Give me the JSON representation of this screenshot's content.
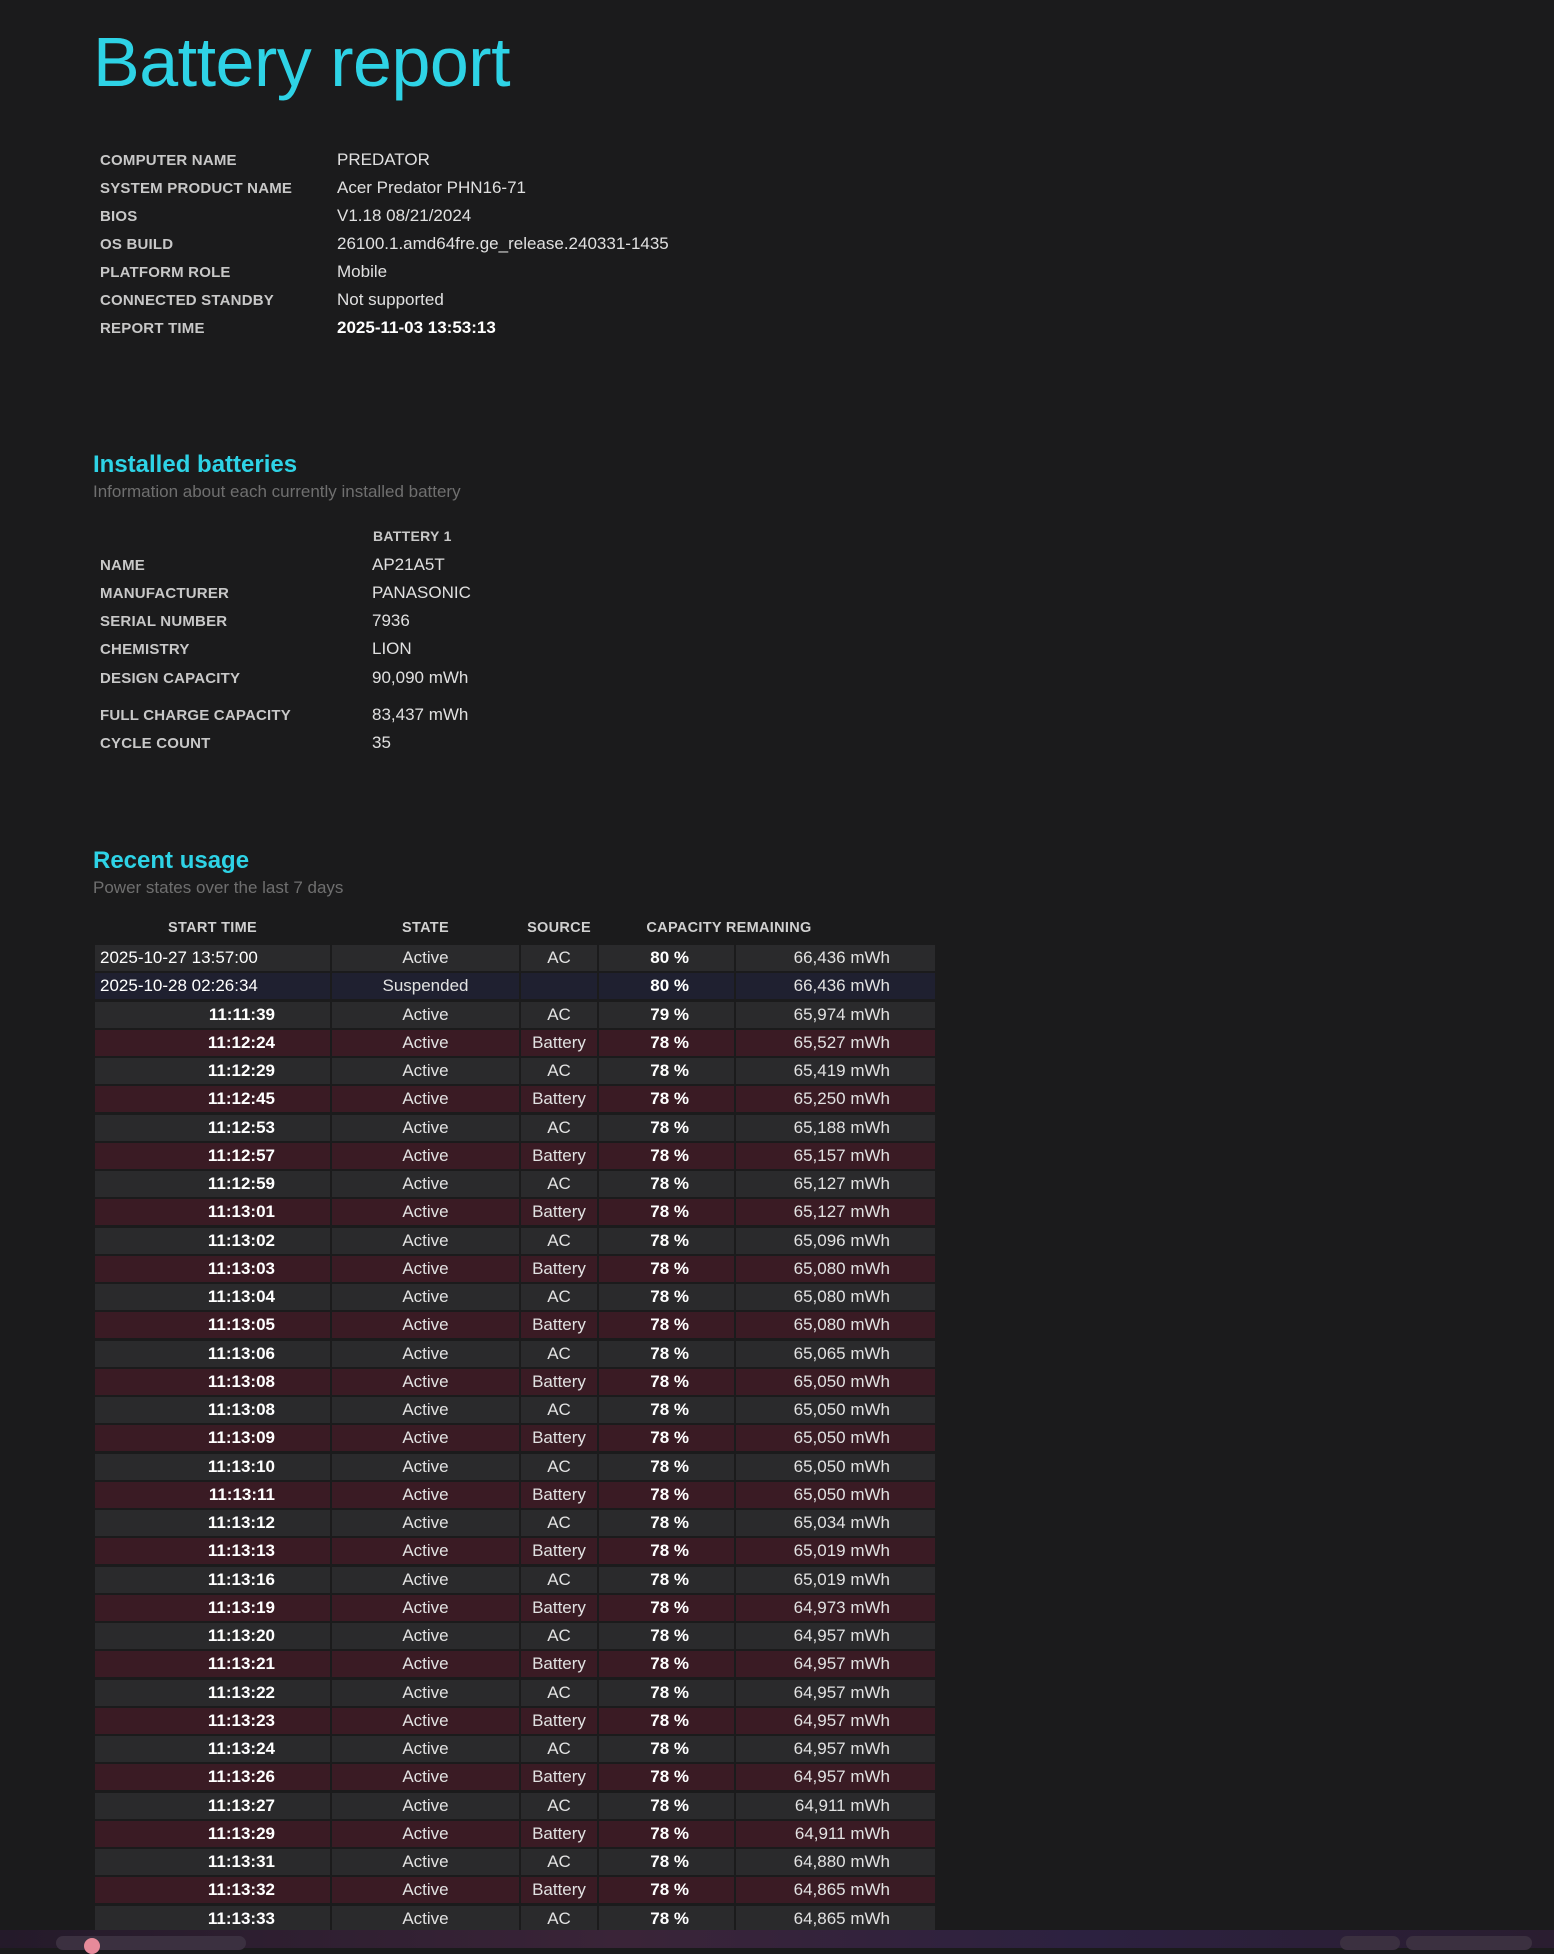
{
  "title": "Battery report",
  "system": [
    {
      "label": "COMPUTER NAME",
      "value": "PREDATOR"
    },
    {
      "label": "SYSTEM PRODUCT NAME",
      "value": "Acer Predator PHN16-71"
    },
    {
      "label": "BIOS",
      "value": "V1.18 08/21/2024"
    },
    {
      "label": "OS BUILD",
      "value": "26100.1.amd64fre.ge_release.240331-1435"
    },
    {
      "label": "PLATFORM ROLE",
      "value": "Mobile"
    },
    {
      "label": "CONNECTED STANDBY",
      "value": "Not supported"
    },
    {
      "label": "REPORT TIME",
      "value": "2025-11-03  13:53:13"
    }
  ],
  "installed": {
    "title": "Installed batteries",
    "subtitle": "Information about each currently installed battery",
    "column": "BATTERY 1",
    "rows": [
      {
        "label": "NAME",
        "value": "AP21A5T"
      },
      {
        "label": "MANUFACTURER",
        "value": "PANASONIC"
      },
      {
        "label": "SERIAL NUMBER",
        "value": "7936"
      },
      {
        "label": "CHEMISTRY",
        "value": "LION"
      },
      {
        "label": "DESIGN CAPACITY",
        "value": "90,090 mWh"
      },
      {
        "label": "FULL CHARGE CAPACITY",
        "value": "83,437 mWh"
      },
      {
        "label": "CYCLE COUNT",
        "value": "35"
      }
    ]
  },
  "usage": {
    "title": "Recent usage",
    "subtitle": "Power states over the last 7 days",
    "headers": {
      "start_time": "START TIME",
      "state": "STATE",
      "source": "SOURCE",
      "capacity": "CAPACITY REMAINING"
    },
    "rows": [
      {
        "time": "2025-10-27  13:57:00",
        "state": "Active",
        "source": "AC",
        "pct": "80 %",
        "cap": "66,436 mWh"
      },
      {
        "time": "2025-10-28  02:26:34",
        "state": "Suspended",
        "source": "",
        "pct": "80 %",
        "cap": "66,436 mWh"
      },
      {
        "time": "11:11:39",
        "state": "Active",
        "source": "AC",
        "pct": "79 %",
        "cap": "65,974 mWh"
      },
      {
        "time": "11:12:24",
        "state": "Active",
        "source": "Battery",
        "pct": "78 %",
        "cap": "65,527 mWh"
      },
      {
        "time": "11:12:29",
        "state": "Active",
        "source": "AC",
        "pct": "78 %",
        "cap": "65,419 mWh"
      },
      {
        "time": "11:12:45",
        "state": "Active",
        "source": "Battery",
        "pct": "78 %",
        "cap": "65,250 mWh"
      },
      {
        "time": "11:12:53",
        "state": "Active",
        "source": "AC",
        "pct": "78 %",
        "cap": "65,188 mWh"
      },
      {
        "time": "11:12:57",
        "state": "Active",
        "source": "Battery",
        "pct": "78 %",
        "cap": "65,157 mWh"
      },
      {
        "time": "11:12:59",
        "state": "Active",
        "source": "AC",
        "pct": "78 %",
        "cap": "65,127 mWh"
      },
      {
        "time": "11:13:01",
        "state": "Active",
        "source": "Battery",
        "pct": "78 %",
        "cap": "65,127 mWh"
      },
      {
        "time": "11:13:02",
        "state": "Active",
        "source": "AC",
        "pct": "78 %",
        "cap": "65,096 mWh"
      },
      {
        "time": "11:13:03",
        "state": "Active",
        "source": "Battery",
        "pct": "78 %",
        "cap": "65,080 mWh"
      },
      {
        "time": "11:13:04",
        "state": "Active",
        "source": "AC",
        "pct": "78 %",
        "cap": "65,080 mWh"
      },
      {
        "time": "11:13:05",
        "state": "Active",
        "source": "Battery",
        "pct": "78 %",
        "cap": "65,080 mWh"
      },
      {
        "time": "11:13:06",
        "state": "Active",
        "source": "AC",
        "pct": "78 %",
        "cap": "65,065 mWh"
      },
      {
        "time": "11:13:08",
        "state": "Active",
        "source": "Battery",
        "pct": "78 %",
        "cap": "65,050 mWh"
      },
      {
        "time": "11:13:08",
        "state": "Active",
        "source": "AC",
        "pct": "78 %",
        "cap": "65,050 mWh"
      },
      {
        "time": "11:13:09",
        "state": "Active",
        "source": "Battery",
        "pct": "78 %",
        "cap": "65,050 mWh"
      },
      {
        "time": "11:13:10",
        "state": "Active",
        "source": "AC",
        "pct": "78 %",
        "cap": "65,050 mWh"
      },
      {
        "time": "11:13:11",
        "state": "Active",
        "source": "Battery",
        "pct": "78 %",
        "cap": "65,050 mWh"
      },
      {
        "time": "11:13:12",
        "state": "Active",
        "source": "AC",
        "pct": "78 %",
        "cap": "65,034 mWh"
      },
      {
        "time": "11:13:13",
        "state": "Active",
        "source": "Battery",
        "pct": "78 %",
        "cap": "65,019 mWh"
      },
      {
        "time": "11:13:16",
        "state": "Active",
        "source": "AC",
        "pct": "78 %",
        "cap": "65,019 mWh"
      },
      {
        "time": "11:13:19",
        "state": "Active",
        "source": "Battery",
        "pct": "78 %",
        "cap": "64,973 mWh"
      },
      {
        "time": "11:13:20",
        "state": "Active",
        "source": "AC",
        "pct": "78 %",
        "cap": "64,957 mWh"
      },
      {
        "time": "11:13:21",
        "state": "Active",
        "source": "Battery",
        "pct": "78 %",
        "cap": "64,957 mWh"
      },
      {
        "time": "11:13:22",
        "state": "Active",
        "source": "AC",
        "pct": "78 %",
        "cap": "64,957 mWh"
      },
      {
        "time": "11:13:23",
        "state": "Active",
        "source": "Battery",
        "pct": "78 %",
        "cap": "64,957 mWh"
      },
      {
        "time": "11:13:24",
        "state": "Active",
        "source": "AC",
        "pct": "78 %",
        "cap": "64,957 mWh"
      },
      {
        "time": "11:13:26",
        "state": "Active",
        "source": "Battery",
        "pct": "78 %",
        "cap": "64,957 mWh"
      },
      {
        "time": "11:13:27",
        "state": "Active",
        "source": "AC",
        "pct": "78 %",
        "cap": "64,911 mWh"
      },
      {
        "time": "11:13:29",
        "state": "Active",
        "source": "Battery",
        "pct": "78 %",
        "cap": "64,911 mWh"
      },
      {
        "time": "11:13:31",
        "state": "Active",
        "source": "AC",
        "pct": "78 %",
        "cap": "64,880 mWh"
      },
      {
        "time": "11:13:32",
        "state": "Active",
        "source": "Battery",
        "pct": "78 %",
        "cap": "64,865 mWh"
      },
      {
        "time": "11:13:33",
        "state": "Active",
        "source": "AC",
        "pct": "78 %",
        "cap": "64,865 mWh"
      }
    ]
  },
  "colors": {
    "accent": "#2ed3e6",
    "ac_row": "#2a2a2c",
    "battery_row": "#3a1b24",
    "suspended_row": "#1f2030"
  }
}
